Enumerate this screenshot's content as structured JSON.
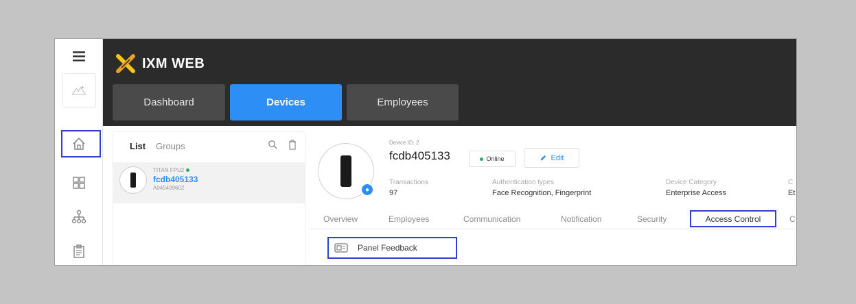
{
  "app": {
    "title": "IXM WEB"
  },
  "nav": {
    "tabs": [
      {
        "label": "Dashboard"
      },
      {
        "label": "Devices"
      },
      {
        "label": "Employees"
      }
    ],
    "active": "Devices"
  },
  "rail": {
    "items": [
      {
        "icon": "menu-icon"
      },
      {
        "icon": "org-logo-icon"
      },
      {
        "icon": "home-icon"
      },
      {
        "icon": "devices-icon"
      },
      {
        "icon": "organization-icon"
      },
      {
        "icon": "clipboard-icon"
      }
    ]
  },
  "list_panel": {
    "tabs": {
      "list": "List",
      "groups": "Groups"
    },
    "devices": [
      {
        "model": "TITAN FPU2",
        "name": "fcdb405133",
        "serial": "A045499602"
      }
    ]
  },
  "device": {
    "id_label": "Device ID: 2",
    "name": "fcdb405133",
    "status": "Online",
    "edit_label": "Edit",
    "stats": [
      {
        "label": "Transactions",
        "value": "97"
      },
      {
        "label": "Authentication types",
        "value": "Face Recognition, Fingerprint"
      },
      {
        "label": "Device Category",
        "value": "Enterprise Access"
      },
      {
        "label": "C",
        "value": "Et"
      }
    ],
    "tabs": [
      {
        "label": "Overview"
      },
      {
        "label": "Employees"
      },
      {
        "label": "Communication"
      },
      {
        "label": "Notification"
      },
      {
        "label": "Security"
      },
      {
        "label": "Access Control"
      },
      {
        "label": "C"
      }
    ],
    "active_tab": "Access Control",
    "submenu": {
      "label": "Panel Feedback"
    }
  },
  "colors": {
    "header_bg": "#2b2b2b",
    "accent": "#2d8ef5",
    "highlight": "#2f3ed7",
    "online": "#27ae60",
    "brand_x_left": "#f5c518",
    "brand_x_right": "#e8a020"
  }
}
